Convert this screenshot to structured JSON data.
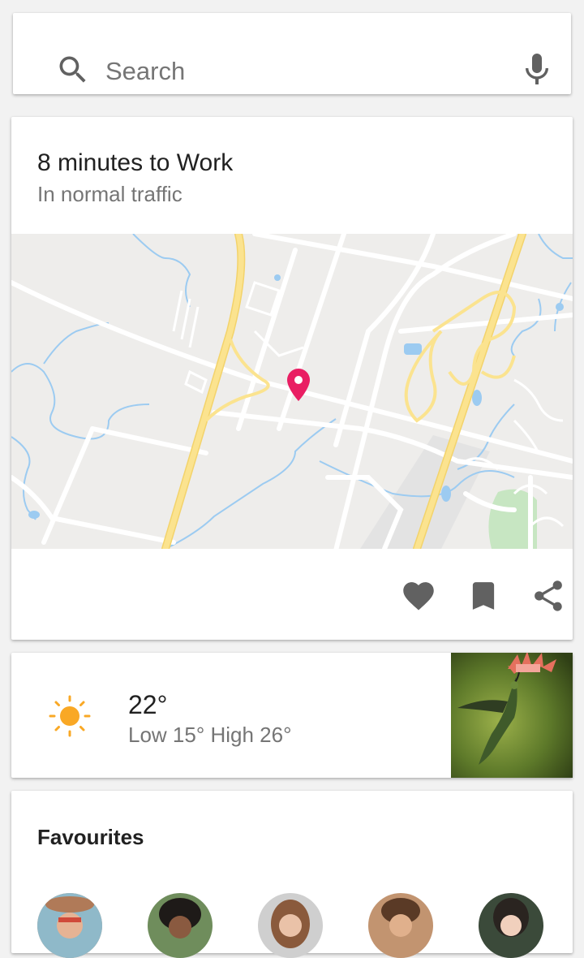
{
  "search": {
    "placeholder": "Search",
    "value": ""
  },
  "commute": {
    "title": "8 minutes to Work",
    "subtitle": "In normal traffic",
    "actions": [
      "favorite-icon",
      "bookmark-icon",
      "share-icon"
    ]
  },
  "weather": {
    "temperature": "22°",
    "range": "Low 15° High 26°",
    "icon": "sun-icon"
  },
  "favourites": {
    "title": "Favourites",
    "people": [
      "contact-1",
      "contact-2",
      "contact-3",
      "contact-4",
      "contact-5"
    ]
  },
  "colors": {
    "marker": "#e91e63",
    "sun": "#f9a825",
    "icon_gray": "#616161",
    "map_bg": "#eeedeb",
    "highway": "#fbe38f",
    "water": "#9ccbf1",
    "park": "#c7e6c2"
  }
}
